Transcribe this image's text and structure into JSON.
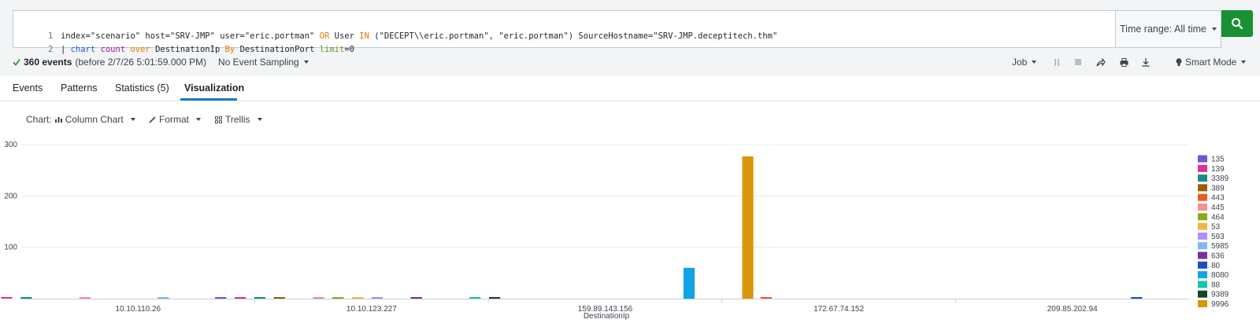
{
  "search": {
    "line1_number": "1",
    "line2_number": "2",
    "line1": [
      {
        "t": "index=\"scenario\" host=\"SRV-JMP\" user=\"eric.portman\" ",
        "c": "def"
      },
      {
        "t": "OR",
        "c": "kw"
      },
      {
        "t": " User ",
        "c": "def"
      },
      {
        "t": "IN",
        "c": "kw"
      },
      {
        "t": " (\"DECEPT\\\\eric.portman\", \"eric.portman\") SourceHostname=\"SRV-JMP.deceptitech.thm\"",
        "c": "def"
      }
    ],
    "line2": [
      {
        "t": "| ",
        "c": "def"
      },
      {
        "t": "chart",
        "c": "cmd"
      },
      {
        "t": " ",
        "c": "def"
      },
      {
        "t": "count",
        "c": "fn"
      },
      {
        "t": " ",
        "c": "def"
      },
      {
        "t": "over",
        "c": "kw"
      },
      {
        "t": " DestinationIp ",
        "c": "def"
      },
      {
        "t": "By",
        "c": "kw"
      },
      {
        "t": " DestinationPort ",
        "c": "def"
      },
      {
        "t": "limit",
        "c": "arg"
      },
      {
        "t": "=0",
        "c": "def"
      }
    ],
    "time_range_label": "Time range: All time"
  },
  "status": {
    "events_count": "360 events",
    "events_detail": "(before 2/7/26 5:01:59.000 PM)",
    "sampling_label": "No Event Sampling",
    "job_label": "Job",
    "smart_mode_label": "Smart Mode"
  },
  "tabs": [
    {
      "label": "Events"
    },
    {
      "label": "Patterns"
    },
    {
      "label": "Statistics (5)"
    },
    {
      "label": "Visualization"
    }
  ],
  "chart_toolbar": {
    "chart_prefix": "Chart:",
    "chart_type_label": "Column Chart",
    "format_label": "Format",
    "trellis_label": "Trellis"
  },
  "colors": {
    "accent": "#1f7ac4",
    "search_button": "#1a9035"
  },
  "chart_data": {
    "type": "bar",
    "xlabel": "DestinationIp",
    "ylabel": "",
    "ylim": [
      0,
      300
    ],
    "yticks": [
      100,
      200,
      300
    ],
    "grid": true,
    "legend_position": "right",
    "categories": [
      "10.10.110.26",
      "10.10.123.227",
      "159.89.143.156",
      "172.67.74.152",
      "209.85.202.94"
    ],
    "series": [
      {
        "name": "135",
        "color": "#6f55d6",
        "values": [
          1,
          1,
          0,
          0,
          0
        ]
      },
      {
        "name": "139",
        "color": "#d7339b",
        "values": [
          1,
          1,
          0,
          0,
          0
        ]
      },
      {
        "name": "3389",
        "color": "#148f84",
        "values": [
          1,
          1,
          0,
          0,
          0
        ]
      },
      {
        "name": "389",
        "color": "#9c5c08",
        "values": [
          0,
          1,
          0,
          0,
          0
        ]
      },
      {
        "name": "443",
        "color": "#ef5a20",
        "values": [
          0,
          0,
          0,
          1,
          0
        ]
      },
      {
        "name": "445",
        "color": "#f6918f",
        "values": [
          1,
          1,
          0,
          0,
          0
        ]
      },
      {
        "name": "464",
        "color": "#8aa917",
        "values": [
          0,
          1,
          0,
          0,
          0
        ]
      },
      {
        "name": "53",
        "color": "#f1b547",
        "values": [
          0,
          1,
          0,
          0,
          0
        ]
      },
      {
        "name": "593",
        "color": "#b38df2",
        "values": [
          0,
          1,
          0,
          0,
          0
        ]
      },
      {
        "name": "5985",
        "color": "#7cb9f6",
        "values": [
          1,
          0,
          0,
          0,
          0
        ]
      },
      {
        "name": "636",
        "color": "#7d2f96",
        "values": [
          0,
          1,
          0,
          0,
          0
        ]
      },
      {
        "name": "80",
        "color": "#1c4fc1",
        "values": [
          0,
          0,
          0,
          0,
          1
        ]
      },
      {
        "name": "8080",
        "color": "#12a3e7",
        "values": [
          0,
          0,
          60,
          0,
          0
        ]
      },
      {
        "name": "88",
        "color": "#18c7a8",
        "values": [
          0,
          1,
          0,
          0,
          0
        ]
      },
      {
        "name": "9389",
        "color": "#15452c",
        "values": [
          0,
          1,
          0,
          0,
          0
        ]
      },
      {
        "name": "9996",
        "color": "#dc960b",
        "values": [
          0,
          0,
          277,
          0,
          0
        ]
      }
    ]
  }
}
